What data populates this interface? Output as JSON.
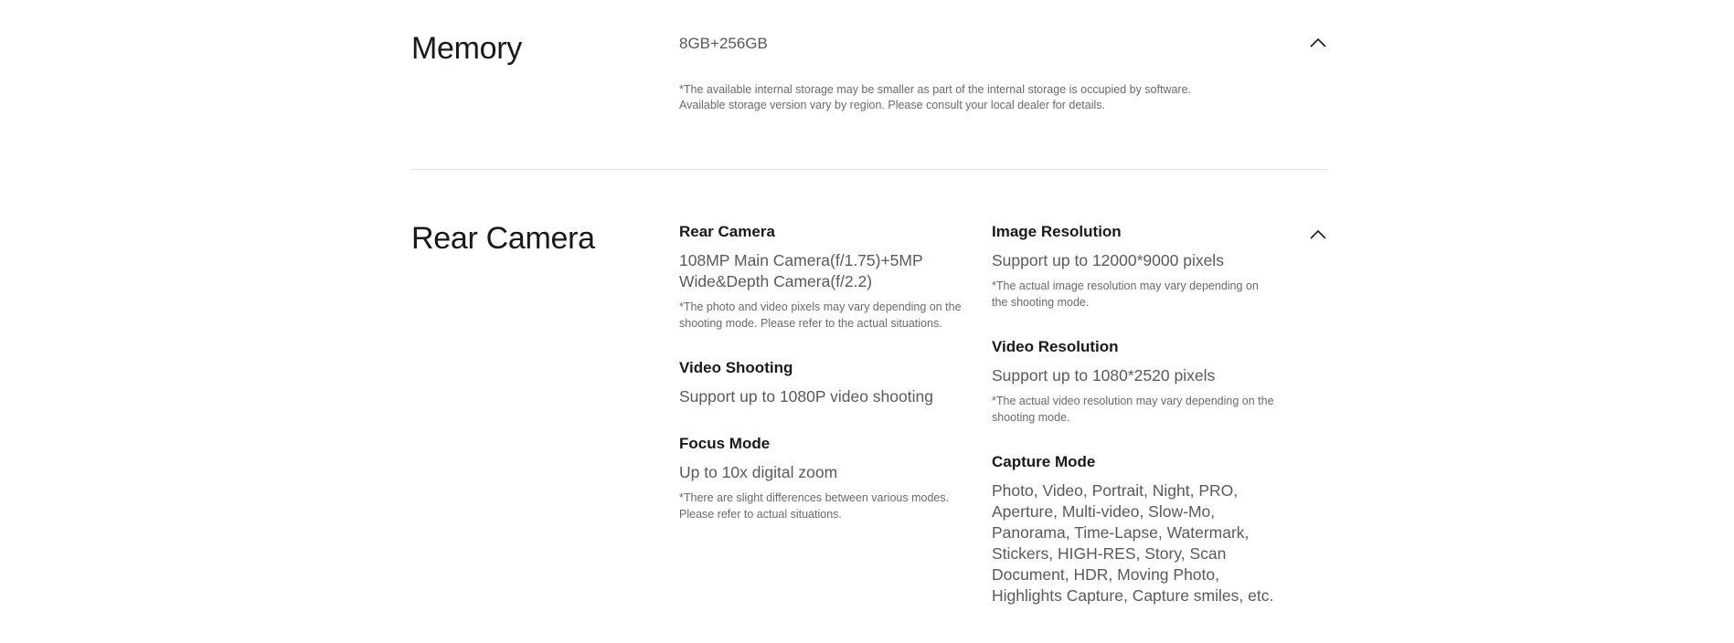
{
  "memory": {
    "title": "Memory",
    "value": "8GB+256GB",
    "note_line1": "*The available internal storage may be smaller as part of the internal storage is occupied by software.",
    "note_line2": "Available storage version vary by region. Please consult your local dealer for details.",
    "toggle_icon": "chevron-up-icon"
  },
  "rear_camera": {
    "title": "Rear Camera",
    "toggle_icon": "chevron-up-icon",
    "left_column": [
      {
        "label": "Rear Camera",
        "value": "108MP Main Camera(f/1.75)+5MP Wide&Depth Camera(f/2.2)",
        "note": "*The photo and video pixels may vary depending on the shooting mode. Please refer to the actual situations."
      },
      {
        "label": "Video Shooting",
        "value": "Support up to 1080P video shooting",
        "note": ""
      },
      {
        "label": "Focus Mode",
        "value": "Up to 10x digital zoom",
        "note": "*There are slight differences between various modes. Please refer to actual situations."
      }
    ],
    "right_column": [
      {
        "label": "Image Resolution",
        "value": "Support up to 12000*9000 pixels",
        "note": "*The actual image resolution may vary depending on the shooting mode."
      },
      {
        "label": "Video Resolution",
        "value": "Support up to 1080*2520 pixels",
        "note": "*The actual video resolution may vary depending on the shooting mode."
      },
      {
        "label": "Capture Mode",
        "value": "Photo, Video, Portrait, Night, PRO, Aperture, Multi-video, Slow-Mo, Panorama, Time-Lapse, Watermark, Stickers, HIGH-RES, Story, Scan Document, HDR, Moving Photo, Highlights Capture, Capture smiles, etc.",
        "note": ""
      }
    ]
  }
}
